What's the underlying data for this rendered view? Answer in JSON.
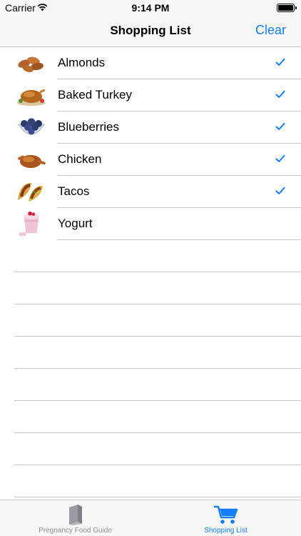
{
  "status_bar": {
    "carrier": "Carrier",
    "time": "9:14 PM"
  },
  "nav": {
    "title": "Shopping List",
    "clear_label": "Clear"
  },
  "items": [
    {
      "name": "Almonds",
      "checked": true,
      "icon": "almonds-icon"
    },
    {
      "name": "Baked Turkey",
      "checked": true,
      "icon": "turkey-icon"
    },
    {
      "name": "Blueberries",
      "checked": true,
      "icon": "blueberries-icon"
    },
    {
      "name": "Chicken",
      "checked": true,
      "icon": "chicken-icon"
    },
    {
      "name": "Tacos",
      "checked": true,
      "icon": "tacos-icon"
    },
    {
      "name": "Yogurt",
      "checked": false,
      "icon": "yogurt-icon"
    }
  ],
  "tabs": [
    {
      "label": "Pregnancy Food Guide",
      "icon": "book-icon",
      "selected": false
    },
    {
      "label": "Shopping List",
      "icon": "cart-icon",
      "selected": true
    }
  ],
  "colors": {
    "accent": "#147efb",
    "tab_inactive": "#8e8e93",
    "separator": "#c8c7cc",
    "bar_background": "#f7f7f7"
  }
}
